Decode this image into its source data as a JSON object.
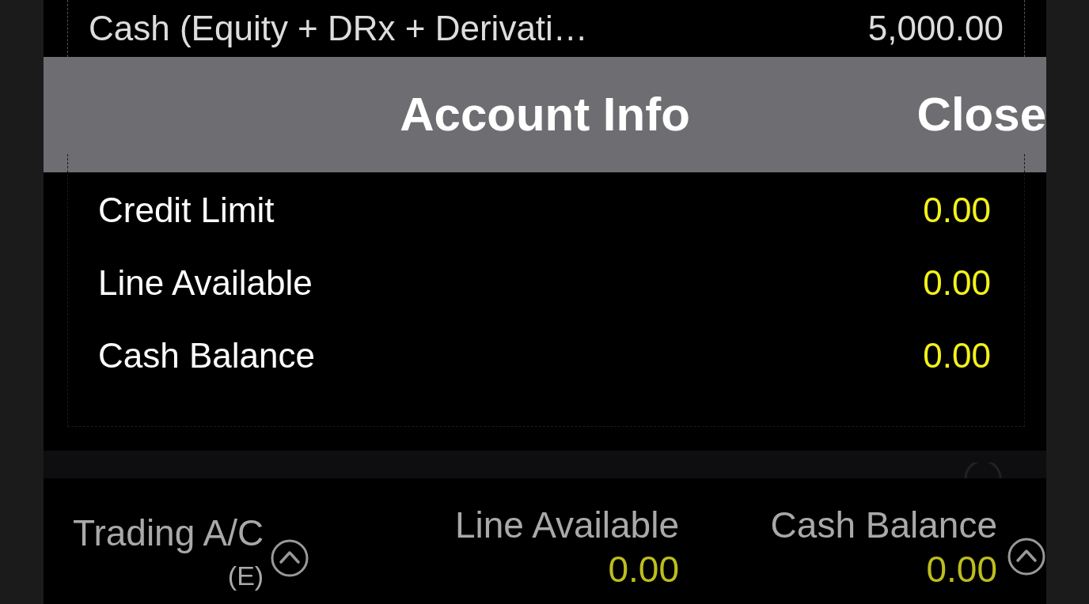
{
  "top_row": {
    "label": "Cash (Equity + DRx + Derivati…",
    "value": "5,000.00"
  },
  "dialog": {
    "title": "Account Info",
    "close": "Close",
    "rows": [
      {
        "label": "Credit Limit",
        "value": "0.00"
      },
      {
        "label": "Line Available",
        "value": "0.00"
      },
      {
        "label": "Cash Balance",
        "value": "0.00"
      }
    ]
  },
  "bottom_bar": {
    "account_label": "Trading A/C",
    "account_suffix": "(E)",
    "columns": [
      {
        "label": "Line Available",
        "value": "0.00"
      },
      {
        "label": "Cash Balance",
        "value": "0.00"
      }
    ]
  }
}
